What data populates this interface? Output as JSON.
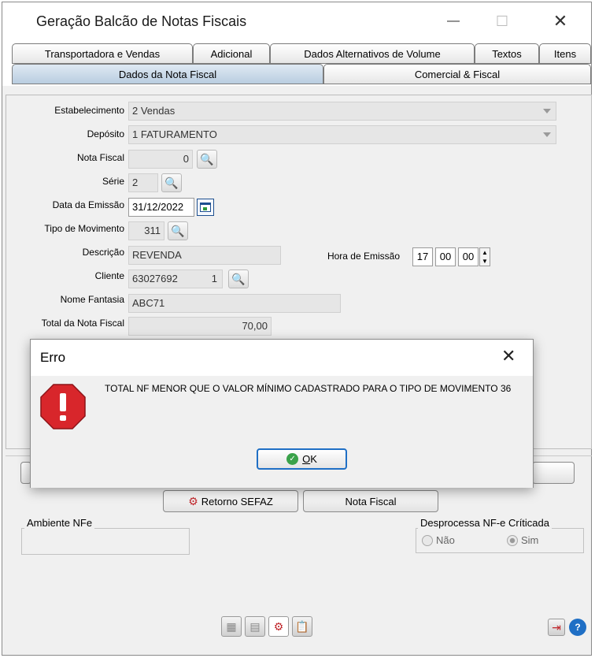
{
  "window": {
    "title": "Geração Balcão de Notas Fiscais",
    "minimize": "—",
    "maximize": "☐",
    "close": "✕"
  },
  "tabs_row1": [
    "Transportadora e Vendas",
    "Adicional",
    "Dados Alternativos de Volume",
    "Textos",
    "Itens"
  ],
  "tabs_row2": [
    "Dados da Nota Fiscal",
    "Comercial & Fiscal"
  ],
  "form": {
    "estabelecimento_label": "Estabelecimento",
    "estabelecimento_value": "2 Vendas",
    "deposito_label": "Depósito",
    "deposito_value": "1 FATURAMENTO",
    "nota_fiscal_label": "Nota Fiscal",
    "nota_fiscal_value": "0",
    "serie_label": "Série",
    "serie_value": "2",
    "data_emissao_label": "Data da Emissão",
    "data_emissao_value": "31/12/2022",
    "tipo_movimento_label": "Tipo de Movimento",
    "tipo_movimento_value": "311",
    "descricao_label": "Descrição",
    "descricao_value": "REVENDA",
    "hora_emissao_label": "Hora de Emissão",
    "hora_h": "17",
    "hora_m": "00",
    "hora_s": "00",
    "cliente_label": "Cliente",
    "cliente_code": "63027692",
    "cliente_num": "1",
    "nome_fantasia_label": "Nome Fantasia",
    "nome_fantasia_value": "ABC71",
    "total_label": "Total da Nota Fiscal",
    "total_value": "70,00"
  },
  "buttons": {
    "retorno_sefaz": "Retorno SEFAZ",
    "nota_fiscal": "Nota Fiscal"
  },
  "ambiente": {
    "title": "Ambiente NFe"
  },
  "desprocessa": {
    "title": "Desprocessa NF-e Críticada",
    "nao": "Não",
    "sim": "Sim"
  },
  "dialog": {
    "title": "Erro",
    "message": "TOTAL NF MENOR QUE O VALOR MÍNIMO CADASTRADO PARA O TIPO DE MOVIMENTO 36",
    "ok_prefix": "",
    "ok_underlined": "O",
    "ok_rest": "K",
    "close": "✕"
  },
  "colors": {
    "error_red": "#d8262b",
    "accent_blue": "#1f6fc5",
    "ok_green": "#3aa24a"
  }
}
